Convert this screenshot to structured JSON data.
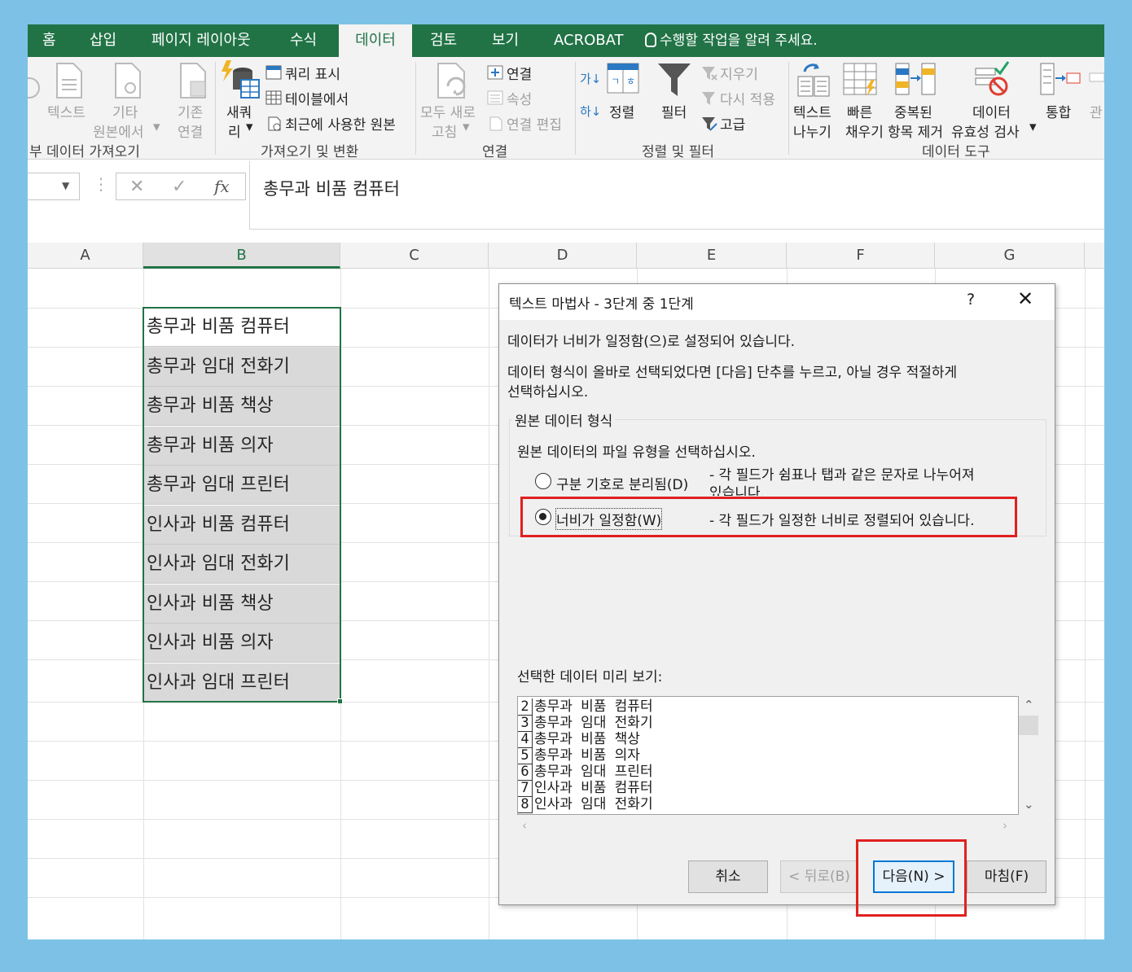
{
  "tabs": {
    "home": "홈",
    "insert": "삽입",
    "page_layout": "페이지 레이아웃",
    "formulas": "수식",
    "data": "데이터",
    "review": "검토",
    "view": "보기",
    "acrobat": "ACROBAT",
    "tell_me": "수행할 작업을 알려 주세요."
  },
  "ribbon": {
    "get_external": {
      "from_text": "텍스트",
      "other": "기타",
      "other_line2": "원본에서",
      "existing": "기존",
      "existing_line2": "연결",
      "group_label": "부 데이터 가져오기"
    },
    "get_transform": {
      "new_query": "새쿼",
      "new_query_line2": "리",
      "show_queries": "쿼리 표시",
      "from_table": "테이블에서",
      "recent_sources": "최근에 사용한 원본",
      "group_label": "가져오기 및 변환"
    },
    "connections": {
      "refresh_all": "모두 새로",
      "refresh_all_line2": "고침",
      "connections": "연결",
      "properties": "속성",
      "edit_links": "연결 편집",
      "group_label": "연결"
    },
    "sort_filter": {
      "sort": "정렬",
      "filter": "필터",
      "clear": "지우기",
      "reapply": "다시 적용",
      "advanced": "고급",
      "group_label": "정렬 및 필터"
    },
    "data_tools": {
      "text_to_columns": "텍스트",
      "text_to_columns_line2": "나누기",
      "flash_fill": "빠른",
      "flash_fill_line2": "채우기",
      "remove_duplicates": "중복된",
      "remove_duplicates_line2": "항목 제거",
      "data_validation": "데이터",
      "data_validation_line2": "유효성 검사",
      "consolidate": "통합",
      "relationships": "관",
      "group_label": "데이터 도구"
    }
  },
  "formula_bar": {
    "cancel_symbol": "✕",
    "enter_symbol": "✓",
    "fx_symbol": "fx",
    "content": "총무과 비품 컴퓨터"
  },
  "columns": [
    "A",
    "B",
    "C",
    "D",
    "E",
    "F",
    "G"
  ],
  "cells": [
    "총무과 비품 컴퓨터",
    "총무과 임대 전화기",
    "총무과 비품 책상",
    "총무과 비품 의자",
    "총무과 임대 프린터",
    "인사과 비품 컴퓨터",
    "인사과 임대 전화기",
    "인사과 비품 책상",
    "인사과 비품 의자",
    "인사과 임대 프린터"
  ],
  "dialog": {
    "title": "텍스트 마법사 - 3단계 중 1단계",
    "help": "?",
    "close": "✕",
    "line1": "데이터가 너비가 일정함(으)로 설정되어 있습니다.",
    "line2": "데이터 형식이 올바로 선택되었다면 [다음] 단추를 누르고, 아닐 경우 적절하게",
    "line3": "선택하십시오.",
    "group_title": "원본 데이터 형식",
    "group_prompt": "원본 데이터의 파일 유형을 선택하십시오.",
    "option_delimited": "구분 기호로 분리됨(D)",
    "option_delimited_desc": "- 각 필드가 쉼표나 탭과 같은 문자로 나누어져",
    "option_delimited_desc2": "있습니다.",
    "option_fixed": "너비가 일정함(W)",
    "option_fixed_desc": "- 각 필드가 일정한 너비로 정렬되어 있습니다.",
    "selected_option": "fixed",
    "preview_label": "선택한 데이터 미리 보기:",
    "preview_rows": [
      {
        "num": "2",
        "text": "총무과 비품 컴퓨터"
      },
      {
        "num": "3",
        "text": "총무과 임대 전화기"
      },
      {
        "num": "4",
        "text": "총무과 비품 책상"
      },
      {
        "num": "5",
        "text": "총무과 비품 의자"
      },
      {
        "num": "6",
        "text": "총무과 임대 프린터"
      },
      {
        "num": "7",
        "text": "인사과 비품 컴퓨터"
      },
      {
        "num": "8",
        "text": "인사과 임대 전화기"
      }
    ],
    "buttons": {
      "cancel": "취소",
      "back": "< 뒤로(B)",
      "next": "다음(N) >",
      "finish": "마침(F)"
    }
  },
  "colors": {
    "excel_green": "#217346",
    "highlight_red": "#e02020",
    "background_blue": "#7dc2e6"
  }
}
